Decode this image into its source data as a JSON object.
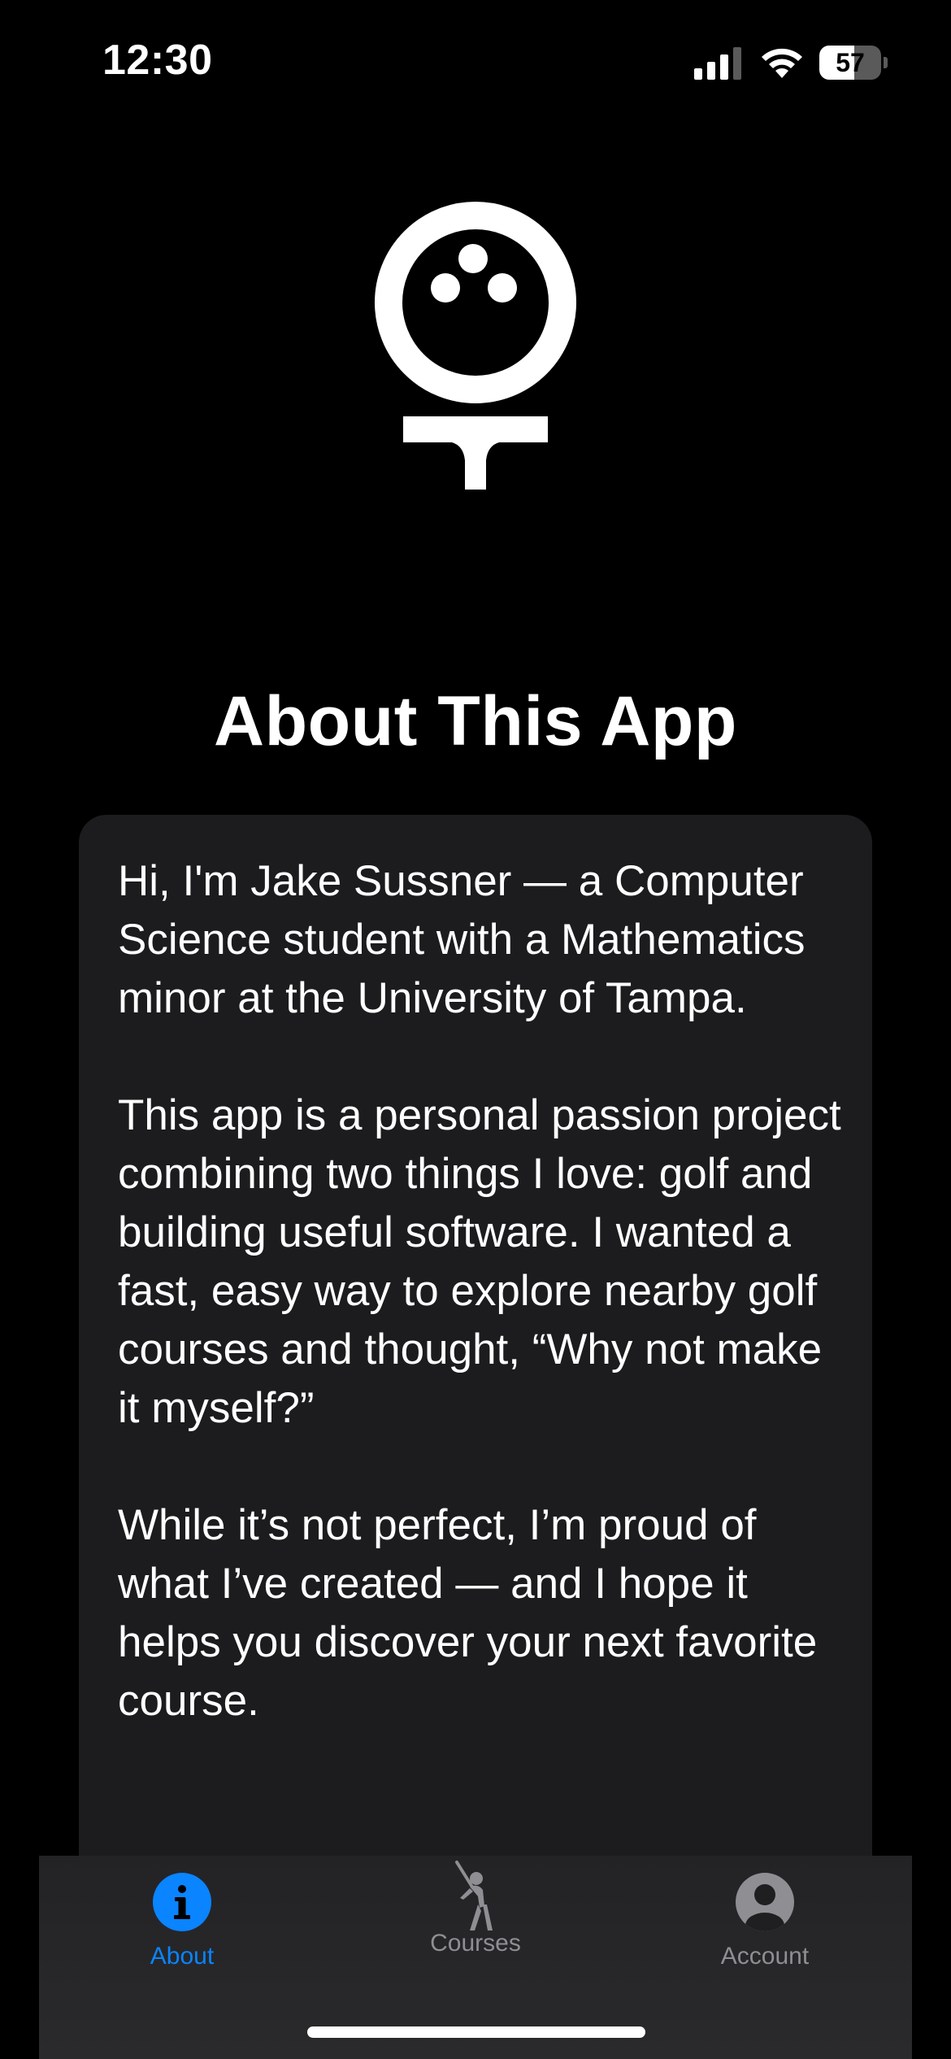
{
  "status_bar": {
    "time": "12:30",
    "battery_level": "57",
    "battery_fraction": 0.57,
    "icons": [
      "signal-icon",
      "wifi-icon",
      "battery-icon"
    ]
  },
  "logo": {
    "icon": "golf-ball-on-tee-icon"
  },
  "page": {
    "title": "About This App"
  },
  "about": {
    "paragraphs": [
      "Hi, I'm Jake Sussner — a Computer Science student with a Mathematics minor at the University of Tampa.",
      "This app is a personal passion project combining two things I love: golf and building useful software. I wanted a fast, easy way to explore nearby golf courses and thought, “Why not make it myself?”",
      "While it’s not perfect, I’m proud of what I’ve created — and I hope it helps you discover your next favorite course."
    ]
  },
  "tab_bar": {
    "tabs": [
      {
        "label": "About",
        "icon": "info-circle-icon",
        "active": true
      },
      {
        "label": "Courses",
        "icon": "golfer-icon",
        "active": false
      },
      {
        "label": "Account",
        "icon": "person-circle-icon",
        "active": false
      }
    ]
  },
  "colors": {
    "background": "#000000",
    "card": "#1c1c1e",
    "accent": "#0a84ff",
    "inactive": "#8e8e93"
  }
}
